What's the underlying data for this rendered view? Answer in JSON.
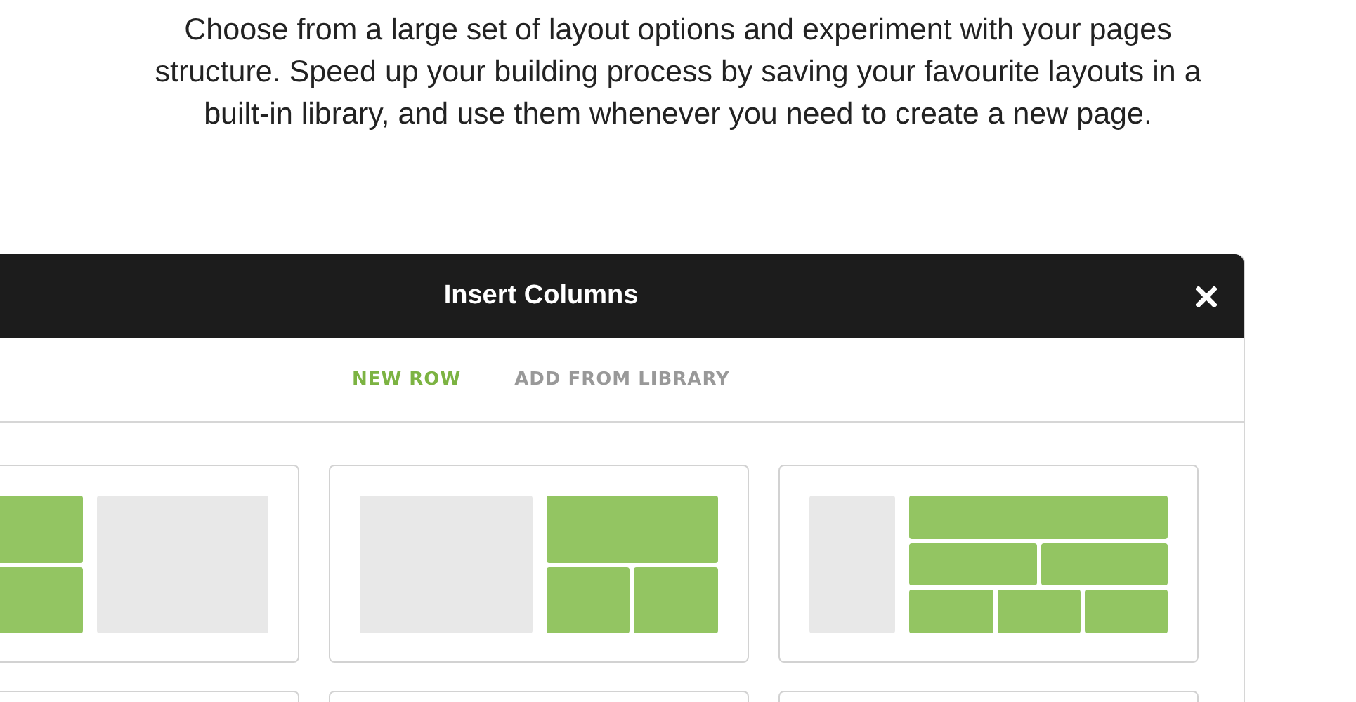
{
  "intro": "Choose from a large set of layout options and experiment with your pages structure. Speed up your building process by saving your favourite layouts in a built-in library, and use them whenever you need to create a new page.",
  "dialog": {
    "title": "Insert Columns",
    "tabs": [
      {
        "label": "NEW ROW",
        "selected": true
      },
      {
        "label": "ADD FROM LIBRARY",
        "selected": false
      }
    ],
    "layouts": [
      {
        "kind": "halves",
        "columns": [
          {
            "filled": true
          },
          {
            "filled": false
          }
        ]
      },
      {
        "kind": "halves-split",
        "columns": [
          {
            "filled": false
          },
          {
            "filled": true
          }
        ]
      },
      {
        "kind": "quarter-grid",
        "columns": [
          {
            "filled": false
          },
          {
            "filled": true
          }
        ]
      }
    ]
  }
}
